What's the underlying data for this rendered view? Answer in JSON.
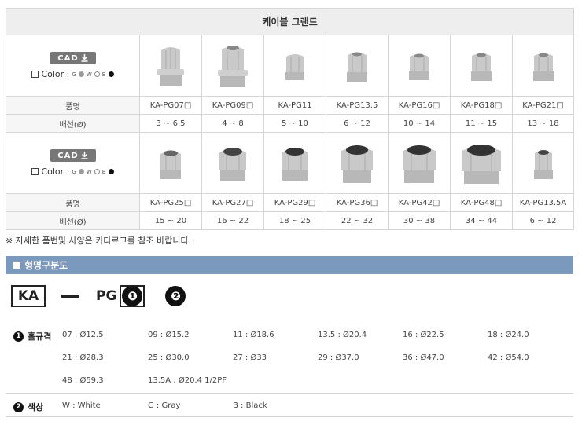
{
  "table": {
    "title": "케이블 그랜드",
    "cad_label": "CAD",
    "color_label": "Color :",
    "color_options": [
      "G",
      "W",
      "B"
    ],
    "row_label_name": "품명",
    "row_label_range": "배선(Ø)",
    "group1": {
      "names": [
        "KA-PG07□",
        "KA-PG09□",
        "KA-PG11",
        "KA-PG13.5",
        "KA-PG16□",
        "KA-PG18□",
        "KA-PG21□"
      ],
      "ranges": [
        "3 ~ 6.5",
        "4 ~ 8",
        "5 ~ 10",
        "6 ~ 12",
        "10 ~ 14",
        "11 ~ 15",
        "13 ~ 18"
      ]
    },
    "group2": {
      "names": [
        "KA-PG25□",
        "KA-PG27□",
        "KA-PG29□",
        "KA-PG36□",
        "KA-PG42□",
        "KA-PG48□",
        "KA-PG13.5A"
      ],
      "ranges": [
        "15 ~ 20",
        "16 ~ 22",
        "18 ~ 25",
        "22 ~ 32",
        "30 ~ 38",
        "34 ~ 44",
        "6 ~ 12"
      ]
    }
  },
  "note": "※ 자세한 품번및 사양은 카다르그를 참조 바랍니다.",
  "section_title": "형명구분도",
  "model_code": {
    "prefix": "KA",
    "series": "PG",
    "badge1": "❶",
    "badge2": "❷"
  },
  "spec": {
    "size_label": "홀규격",
    "size_badge": "1",
    "sizes": [
      "07 : Ø12.5",
      "09 : Ø15.2",
      "11 : Ø18.6",
      "13.5 : Ø20.4",
      "16 : Ø22.5",
      "18 : Ø24.0",
      "21 : Ø28.3",
      "25 : Ø30.0",
      "27 : Ø33",
      "29 : Ø37.0",
      "36 : Ø47.0",
      "42 : Ø54.0",
      "48 : Ø59.3",
      "13.5A : Ø20.4 1/2PF"
    ],
    "color_label": "색상",
    "color_badge": "2",
    "colors": [
      "W : White",
      "G : Gray",
      "B : Black"
    ]
  },
  "colors": {
    "section_bar": "#7b98bd",
    "gland_gray": "#c4c4c4"
  }
}
